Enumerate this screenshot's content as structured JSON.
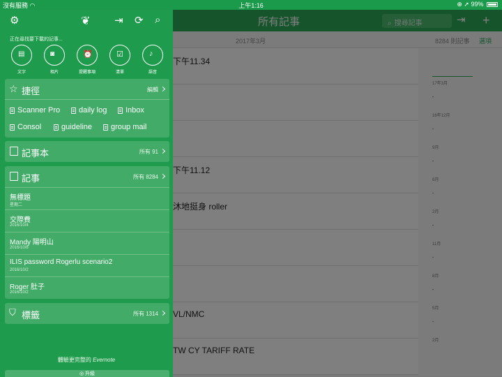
{
  "status": {
    "carrier": "沒有服務",
    "time": "上午1:16",
    "battery": "99%"
  },
  "main": {
    "title": "所有記事",
    "search_placeholder": "搜尋記事",
    "month_label": "2017年3月",
    "note_count": "8284 則記事",
    "options_label": "選項",
    "notes": [
      "下午11.34",
      "",
      "",
      "下午11.12",
      "沐地挺身 roller",
      "",
      "",
      "VL/NMC",
      "TW CY TARIFF RATE"
    ],
    "timeline": [
      {
        "label": "17年3月"
      },
      {
        "label": "16年12月"
      },
      {
        "label": "9月"
      },
      {
        "label": "6月"
      },
      {
        "label": "2月"
      },
      {
        "label": "11月"
      },
      {
        "label": "8月"
      },
      {
        "label": "5月"
      },
      {
        "label": "2月"
      }
    ]
  },
  "drawer": {
    "finding_text": "正在尋找要下載的記事...",
    "quick_actions": [
      {
        "label": "文字",
        "icon": "text-note-icon"
      },
      {
        "label": "相片",
        "icon": "camera-icon"
      },
      {
        "label": "提醒事項",
        "icon": "alarm-clock-icon"
      },
      {
        "label": "清單",
        "icon": "checklist-icon"
      },
      {
        "label": "語音",
        "icon": "microphone-icon"
      }
    ],
    "shortcuts": {
      "title": "捷徑",
      "edit_label": "編輯",
      "items": [
        "Scanner Pro",
        "daily log",
        "Inbox",
        "Consol",
        "guideline",
        "group mail"
      ]
    },
    "notebooks": {
      "title": "記事本",
      "meta": "所有 91"
    },
    "notes_section": {
      "title": "記事",
      "meta": "所有 8284",
      "items": [
        {
          "title": "無標題",
          "date": "星期二"
        },
        {
          "title": "交際費",
          "date": "2016/10/4"
        },
        {
          "title": "Mandy 陽明山",
          "date": "2016/10/8"
        },
        {
          "title": "ILIS password Rogerlu  scenario2",
          "date": "2016/10/2"
        },
        {
          "title": "Roger 肚子",
          "date": "2016/10/2"
        }
      ]
    },
    "tags": {
      "title": "標籤",
      "meta": "所有 1314"
    },
    "premium_text": "體驗更完整的",
    "premium_brand": "Evernote",
    "upgrade_label": "升級"
  }
}
